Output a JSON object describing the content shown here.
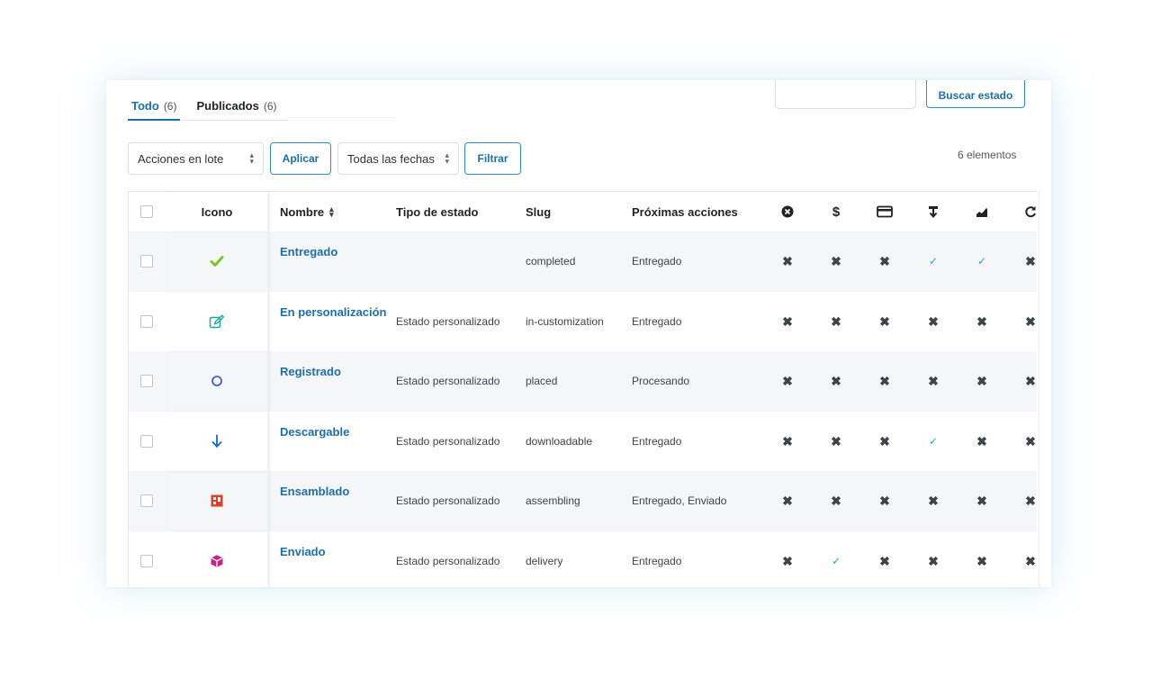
{
  "tabs": [
    {
      "label": "Todo",
      "count": "(6)"
    },
    {
      "label": "Publicados",
      "count": "(6)"
    }
  ],
  "search": {
    "button_label": "Buscar estado",
    "value": ""
  },
  "toolbar": {
    "bulk_actions": "Acciones en lote",
    "apply": "Aplicar",
    "dates": "Todas las fechas",
    "filter": "Filtrar",
    "items_count": "6 elementos"
  },
  "columns": {
    "icon": "Icono",
    "name": "Nombre",
    "type": "Tipo de estado",
    "slug": "Slug",
    "next": "Próximas acciones",
    "flags": [
      "cancel-circle-icon",
      "dollar-icon",
      "credit-card-icon",
      "download-icon",
      "chart-icon",
      "refresh-icon"
    ]
  },
  "rows": [
    {
      "name": "Entregado",
      "type": "",
      "slug": "completed",
      "next": "Entregado",
      "icon": "check-icon",
      "flags": [
        "x",
        "x",
        "x",
        "ok",
        "ok",
        "x"
      ]
    },
    {
      "name": "En personalización",
      "type": "Estado personalizado",
      "slug": "in-customization",
      "next": "Entregado",
      "icon": "edit-icon",
      "flags": [
        "x",
        "x",
        "x",
        "x",
        "x",
        "x"
      ]
    },
    {
      "name": "Registrado",
      "type": "Estado personalizado",
      "slug": "placed",
      "next": "Procesando",
      "icon": "circle-icon",
      "flags": [
        "x",
        "x",
        "x",
        "x",
        "x",
        "x"
      ]
    },
    {
      "name": "Descargable",
      "type": "Estado personalizado",
      "slug": "downloadable",
      "next": "Entregado",
      "icon": "arrow-down-icon",
      "flags": [
        "x",
        "x",
        "x",
        "ok",
        "x",
        "x"
      ]
    },
    {
      "name": "Ensamblado",
      "type": "Estado personalizado",
      "slug": "assembling",
      "next": "Entregado, Enviado",
      "icon": "assemble-icon",
      "flags": [
        "x",
        "x",
        "x",
        "x",
        "x",
        "x"
      ]
    },
    {
      "name": "Enviado",
      "type": "Estado personalizado",
      "slug": "delivery",
      "next": "Entregado",
      "icon": "box-icon",
      "flags": [
        "x",
        "ok",
        "x",
        "x",
        "x",
        "x"
      ]
    }
  ],
  "colors": {
    "accent": "#1e6fa8",
    "check_green": "#7ac52a",
    "edit_teal": "#23a6a0",
    "circle_blue": "#2b4fd8",
    "arrow_blue": "#1e6fd0",
    "assemble_red": "#d9432a",
    "box_magenta": "#c2268a",
    "ok_cyan": "#25a6d0"
  }
}
